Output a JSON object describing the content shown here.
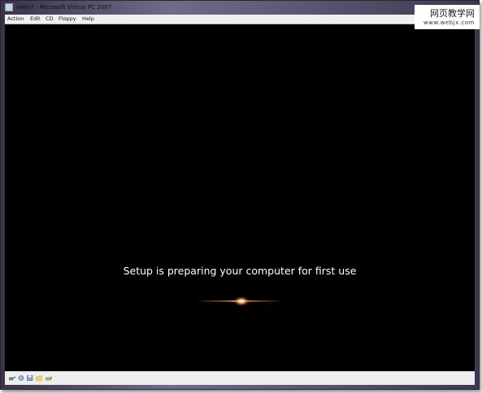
{
  "window": {
    "title": "vWin7 - Microsoft Virtual PC 2007"
  },
  "menu": [
    {
      "label": "Action"
    },
    {
      "label": "Edit"
    },
    {
      "label": "CD"
    },
    {
      "label": "Floppy"
    },
    {
      "label": "Help"
    }
  ],
  "screen": {
    "message": "Setup is preparing your computer for first use"
  },
  "status_icons": [
    "network-icon",
    "sound-icon",
    "disk-icon",
    "folder-icon",
    "usb-icon"
  ],
  "watermark": {
    "line1": "网页教学网",
    "line2": "www.webjx.com"
  }
}
